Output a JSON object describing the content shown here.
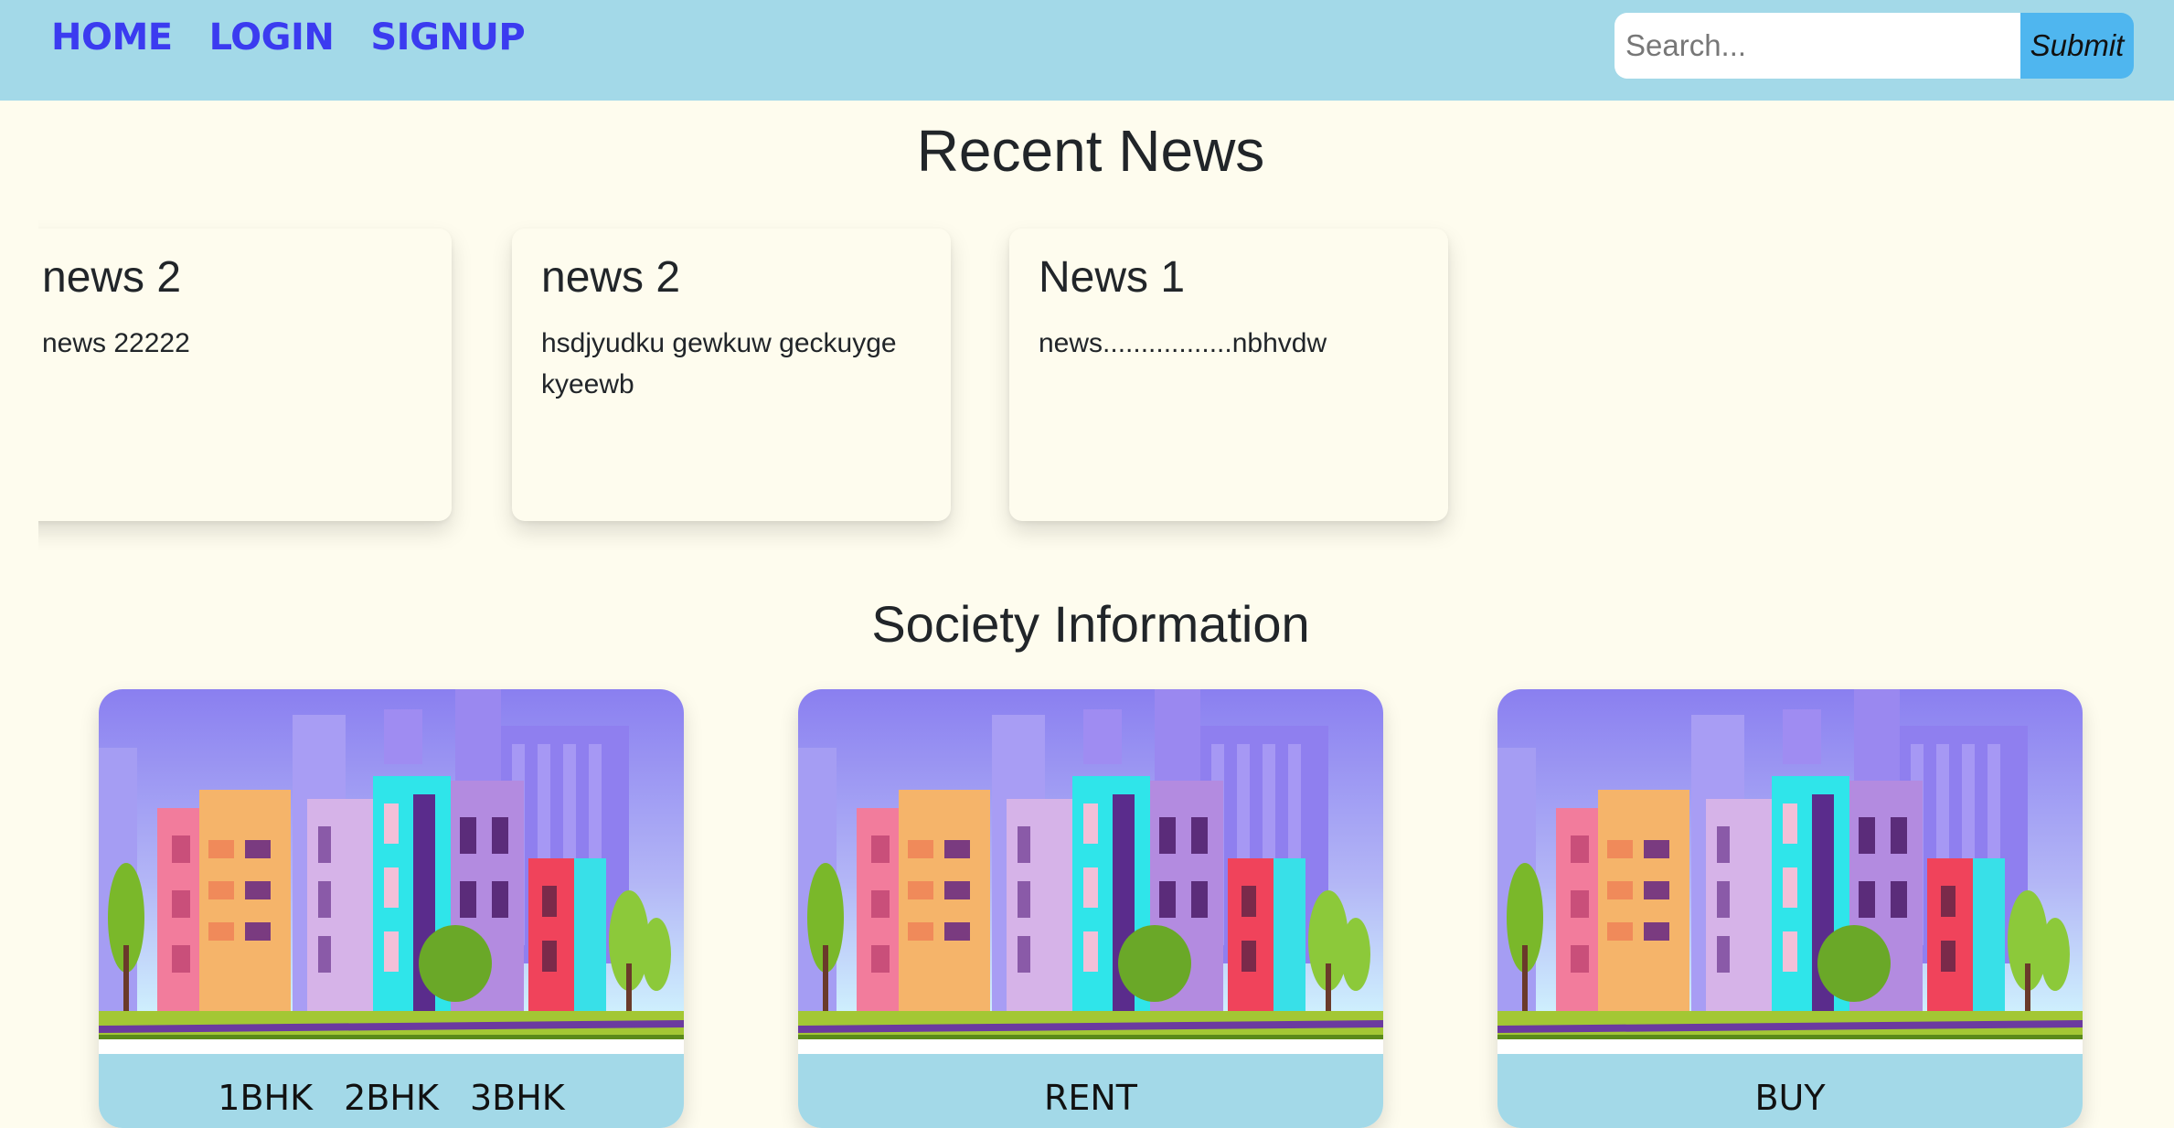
{
  "nav": {
    "links": [
      "HOME",
      "LOGIN",
      "SIGNUP"
    ],
    "search_placeholder": "Search...",
    "submit_label": "Submit"
  },
  "news_section": {
    "title": "Recent News",
    "cards": [
      {
        "title": "news 2",
        "body": "news 22222"
      },
      {
        "title": "news 2",
        "body": "hsdjyudku gewkuw geckuyge kyeewb"
      },
      {
        "title": "News 1",
        "body": "news.................nbhvdw"
      }
    ]
  },
  "society_section": {
    "title": "Society Information",
    "cards": [
      {
        "options": [
          "1BHK",
          "2BHK",
          "3BHK"
        ],
        "image": "city-buildings-illustration"
      },
      {
        "options": [
          "RENT"
        ],
        "image": "city-buildings-illustration"
      },
      {
        "options": [
          "BUY"
        ],
        "image": "city-buildings-illustration"
      }
    ]
  },
  "colors": {
    "page_background": "#fefcee",
    "navbar": "#a3d9e8",
    "nav_link": "#3b3bf0",
    "submit_button": "#4fb6ef"
  }
}
